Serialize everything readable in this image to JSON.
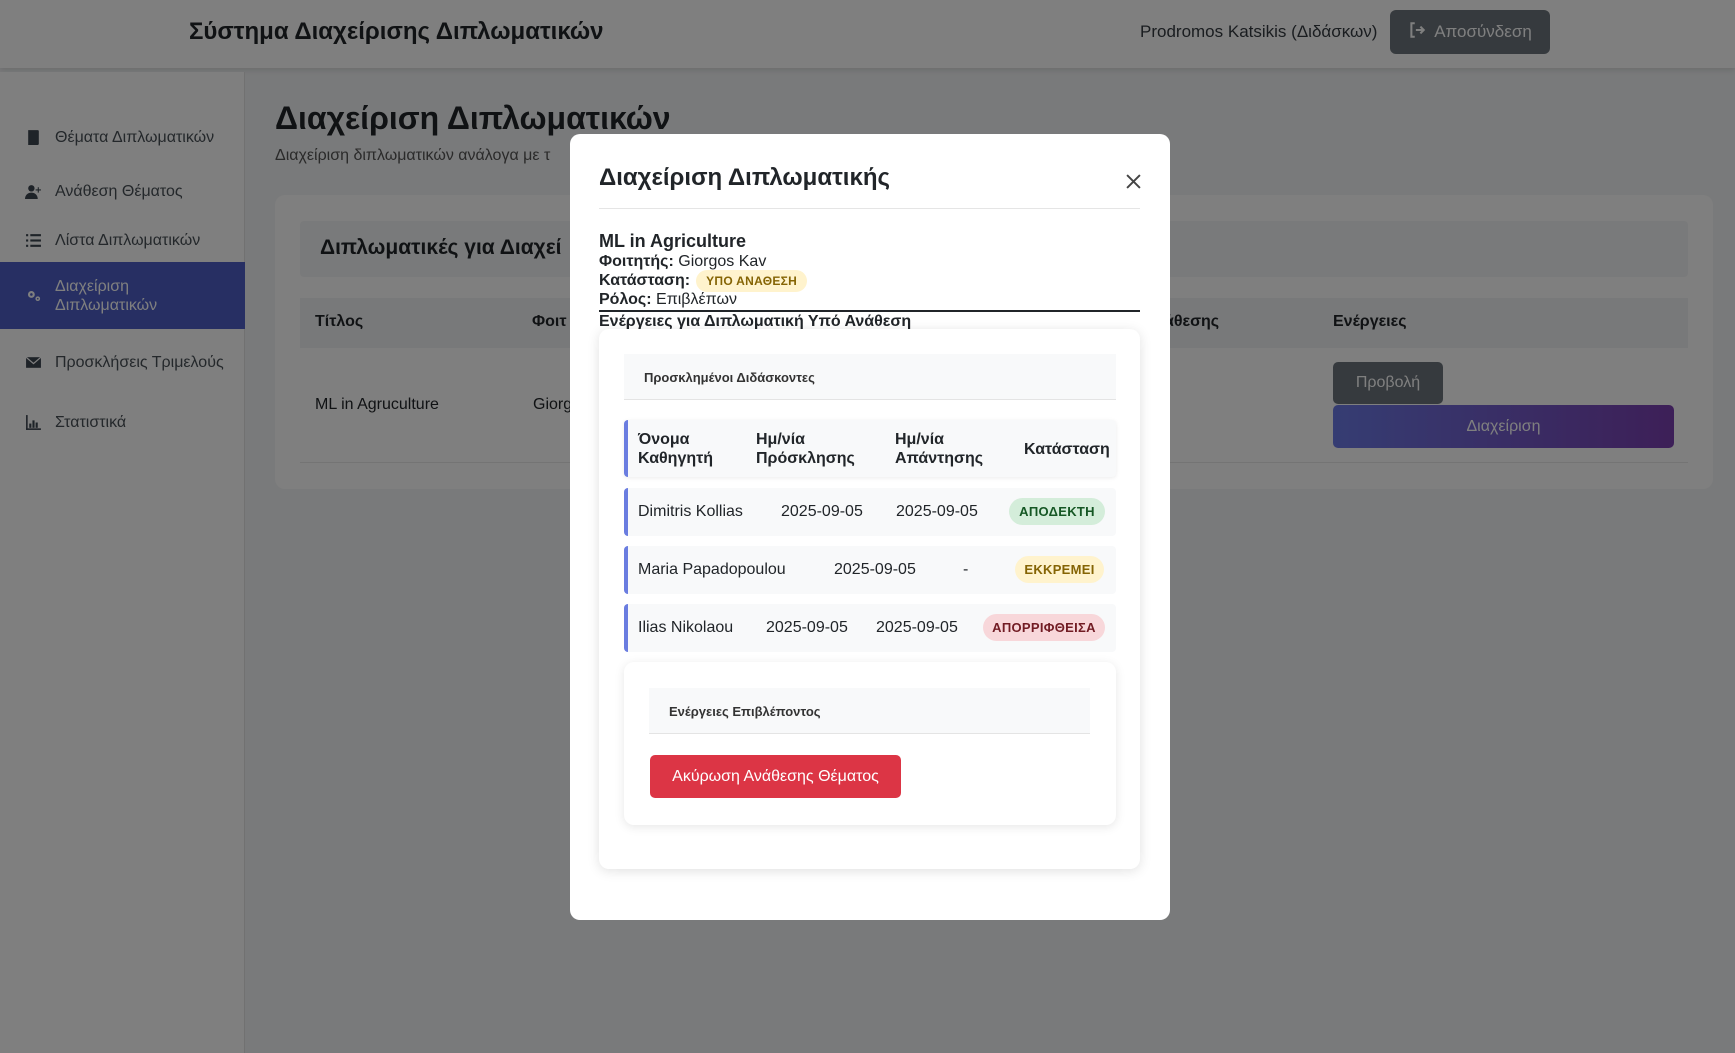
{
  "header": {
    "app_title": "Σύστημα Διαχείρισης Διπλωματικών",
    "user": "Prodromos Katsikis (Διδάσκων)",
    "logout_label": "Αποσύνδεση"
  },
  "sidebar": {
    "items": [
      {
        "label": "Θέματα Διπλωματικών",
        "icon": "book-icon"
      },
      {
        "label": "Ανάθεση Θέματος",
        "icon": "user-plus-icon"
      },
      {
        "label": "Λίστα Διπλωματικών",
        "icon": "list-icon"
      },
      {
        "label": "Διαχείριση Διπλωματικών",
        "icon": "gears-icon",
        "active": true
      },
      {
        "label": "Προσκλήσεις Τριμελούς",
        "icon": "envelope-icon"
      },
      {
        "label": "Στατιστικά",
        "icon": "chart-icon"
      }
    ]
  },
  "main": {
    "title": "Διαχείριση Διπλωματικών",
    "subtitle": "Διαχείριση διπλωματικών ανάλογα με τ",
    "card_title": "Διπλωματικές για Διαχεί",
    "columns": [
      "Τίτλος",
      "Φοιτ",
      "άθεσης",
      "Ενέργειες"
    ],
    "row": {
      "title": "ML in Agruculture",
      "student": "Giorg",
      "view_label": "Προβολή",
      "manage_label": "Διαχείριση"
    }
  },
  "modal": {
    "title": "Διαχείριση Διπλωματικής",
    "thesis_title": "ML in Agriculture",
    "student_label": "Φοιτητής:",
    "student_value": "Giorgos Kav",
    "status_label": "Κατάσταση:",
    "status_value": "ΥΠΟ ΑΝΑΘΕΣΗ",
    "role_label": "Ρόλος:",
    "role_value": "Επιβλέπων",
    "actions_heading": "Ενέργειες για Διπλωματική Υπό Ανάθεση",
    "invited_heading": "Προσκλημένοι Διδάσκοντες",
    "invited_columns": {
      "name_1": "Όνομα",
      "name_2": "Καθηγητή",
      "invite_1": "Ημ/νία",
      "invite_2": "Πρόσκλησης",
      "reply_1": "Ημ/νία",
      "reply_2": "Απάντησης",
      "status": "Κατάσταση"
    },
    "invited": [
      {
        "name": "Dimitris Kollias",
        "invited": "2025-09-05",
        "replied": "2025-09-05",
        "status": "ΑΠΟΔΕΚΤΗ"
      },
      {
        "name": "Maria Papadopoulou",
        "invited": "2025-09-05",
        "replied": "-",
        "status": "ΕΚΚΡΕΜΕΙ"
      },
      {
        "name": "Ilias Nikolaou",
        "invited": "2025-09-05",
        "replied": "2025-09-05",
        "status": "ΑΠΟΡΡΙΦΘΕΙΣΑ"
      }
    ],
    "supervisor_heading": "Ενέργειες Επιβλέποντος",
    "cancel_label": "Ακύρωση Ανάθεσης Θέματος"
  },
  "colors": {
    "accent": "#4e5fc7",
    "danger": "#dc3545",
    "success_bg": "#d4edda",
    "warning_bg": "#fff3cd",
    "error_bg": "#f8d7da"
  }
}
